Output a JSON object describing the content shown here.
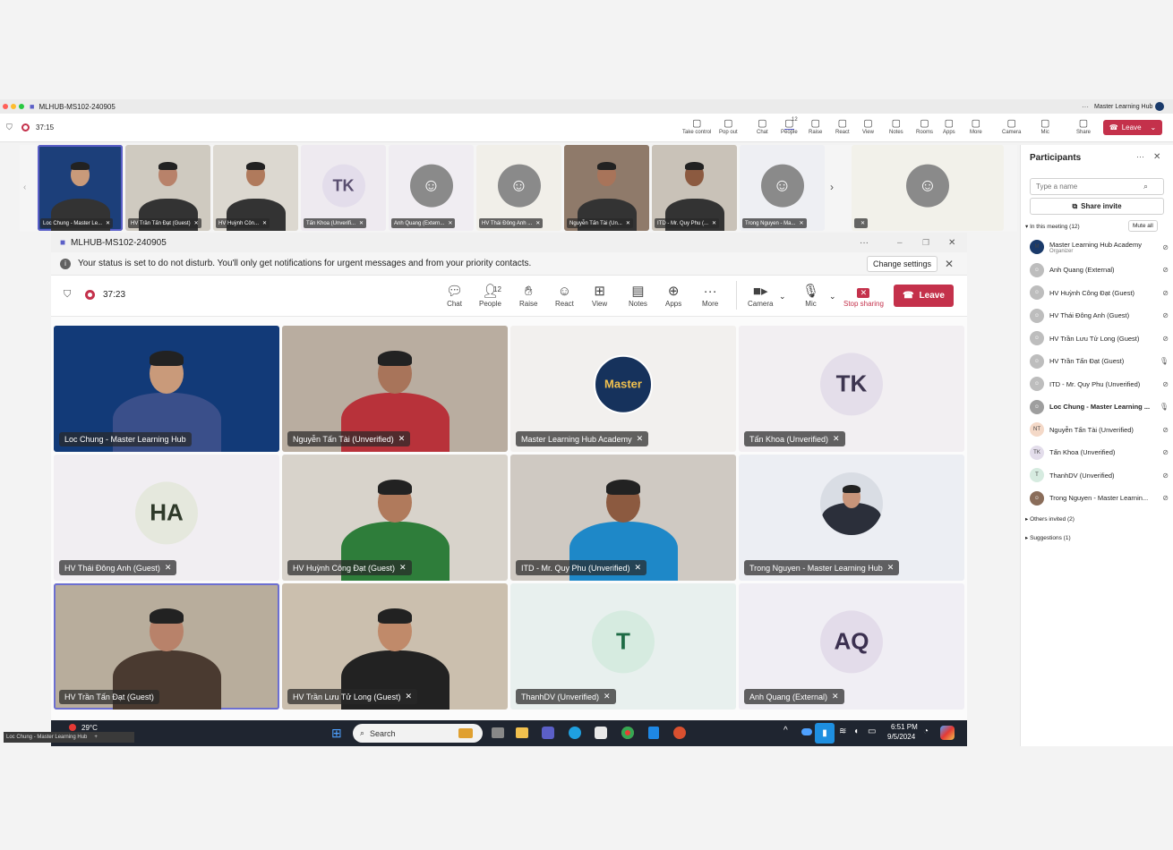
{
  "outer_window": {
    "title": "MLHUB-MS102-240905",
    "account": "Master Learning Hub",
    "timer": "37:15",
    "toolbar": [
      {
        "label": "Take control",
        "icon": "take-control-icon"
      },
      {
        "label": "Pop out",
        "icon": "pop-out-icon"
      },
      {
        "label": "Chat",
        "icon": "chat-icon"
      },
      {
        "label": "People",
        "icon": "people-icon",
        "badge": "12"
      },
      {
        "label": "Raise",
        "icon": "raise-hand-icon"
      },
      {
        "label": "React",
        "icon": "react-icon"
      },
      {
        "label": "View",
        "icon": "view-icon"
      },
      {
        "label": "Notes",
        "icon": "notes-icon"
      },
      {
        "label": "Rooms",
        "icon": "rooms-icon"
      },
      {
        "label": "Apps",
        "icon": "apps-icon"
      },
      {
        "label": "More",
        "icon": "more-icon"
      },
      {
        "label": "Camera",
        "icon": "camera-off-icon"
      },
      {
        "label": "Mic",
        "icon": "mic-off-icon"
      },
      {
        "label": "Share",
        "icon": "share-icon"
      }
    ],
    "leave_label": "Leave"
  },
  "filmstrip": [
    {
      "label": "Loc Chung - Master Le...",
      "kind": "video",
      "bg": "#1c3f7a",
      "skin": "#c99a7a"
    },
    {
      "label": "HV Trần Tấn Đạt (Guest)",
      "kind": "video",
      "bg": "#cfcac0",
      "skin": "#b8826a"
    },
    {
      "label": "HV Huỳnh Côn...",
      "kind": "video",
      "bg": "#dcd8d0",
      "skin": "#b07a5c"
    },
    {
      "label": "Tấn Khoa (Unverifi...",
      "kind": "initials",
      "initials": "TK",
      "bg": "#eeeaf0",
      "circle": "#e3ddeb",
      "color": "#5a4f70"
    },
    {
      "label": "Anh Quang (Extern...",
      "kind": "avatar",
      "bg": "#f0edf2"
    },
    {
      "label": "HV Thái Đông Anh ...",
      "kind": "avatar",
      "bg": "#f1efe9"
    },
    {
      "label": "Nguyễn Tấn Tài (Un...",
      "kind": "video",
      "bg": "#8f7a6a",
      "skin": "#a8745a"
    },
    {
      "label": "ITD - Mr. Quy Phu (...",
      "kind": "video",
      "bg": "#c9c2b8",
      "skin": "#8c5a40"
    },
    {
      "label": "Trong Nguyen - Ma...",
      "kind": "avatar",
      "bg": "#eeeff3"
    },
    {
      "label": "",
      "kind": "avatar",
      "bg": "#f2f1ea"
    }
  ],
  "inner_window": {
    "title": "MLHUB-MS102-240905",
    "dnd_message": "Your status is set to do not disturb. You'll only get notifications for urgent messages and from your priority contacts.",
    "change_settings": "Change settings",
    "timer": "37:23",
    "toolbar": [
      {
        "label": "Chat",
        "icon": "chat-icon"
      },
      {
        "label": "People",
        "icon": "people-icon",
        "badge": "12"
      },
      {
        "label": "Raise",
        "icon": "raise-hand-icon"
      },
      {
        "label": "React",
        "icon": "react-icon"
      },
      {
        "label": "View",
        "icon": "view-icon"
      },
      {
        "label": "Notes",
        "icon": "notes-icon"
      },
      {
        "label": "Apps",
        "icon": "apps-icon"
      },
      {
        "label": "More",
        "icon": "more-icon"
      }
    ],
    "camera_label": "Camera",
    "mic_label": "Mic",
    "stop_sharing_label": "Stop sharing",
    "leave_label": "Leave"
  },
  "grid": [
    {
      "label": "Loc Chung - Master Learning Hub",
      "kind": "video",
      "bg": "#123a78",
      "skin": "#c99a7a",
      "shirt": "#3a4f8a",
      "muted": false
    },
    {
      "label": "Nguyễn Tấn Tài (Unverified)",
      "kind": "video",
      "bg": "#b9ada0",
      "skin": "#a8745a",
      "shirt": "#b8323a",
      "muted": true
    },
    {
      "label": "Master Learning Hub Academy",
      "kind": "logo",
      "bg": "#f2f0ee",
      "logo_text": "Master",
      "muted": true
    },
    {
      "label": "Tấn Khoa (Unverified)",
      "kind": "initials",
      "initials": "TK",
      "bg": "#f2eff2",
      "circle": "#e4deea",
      "color": "#3d3550",
      "muted": true
    },
    {
      "label": "HV Thái Đông Anh (Guest)",
      "kind": "initials",
      "initials": "HA",
      "bg": "#f1eef2",
      "circle": "#e5e8dd",
      "color": "#2f3a2a",
      "muted": true
    },
    {
      "label": "HV Huỳnh Công Đạt (Guest)",
      "kind": "video",
      "bg": "#d8d3cb",
      "skin": "#b07a5c",
      "shirt": "#2e7d3a",
      "muted": true
    },
    {
      "label": "ITD - Mr. Quy Phu (Unverified)",
      "kind": "video",
      "bg": "#cfc9c2",
      "skin": "#8c5a40",
      "shirt": "#1e88c8",
      "muted": true
    },
    {
      "label": "Trong Nguyen - Master Learning Hub",
      "kind": "photo",
      "bg": "#eceef3",
      "skin": "#c8957a",
      "shirt": "#2b2f3a",
      "muted": true
    },
    {
      "label": "HV Trần Tấn Đạt (Guest)",
      "kind": "video",
      "bg": "#b8ad9c",
      "skin": "#b8826a",
      "shirt": "#4a3a30",
      "muted": false
    },
    {
      "label": "HV Trần Lưu Tử Long (Guest)",
      "kind": "video",
      "bg": "#cbbfae",
      "skin": "#c08a6a",
      "shirt": "#222222",
      "muted": true
    },
    {
      "label": "ThanhDV (Unverified)",
      "kind": "initials",
      "initials": "T",
      "bg": "#e8f0ee",
      "circle": "#d6ebe0",
      "color": "#1e6b45",
      "muted": true
    },
    {
      "label": "Anh Quang (External)",
      "kind": "initials",
      "initials": "AQ",
      "bg": "#f0eef4",
      "circle": "#e3dcea",
      "color": "#3b3050",
      "muted": true
    }
  ],
  "taskbar": {
    "weather": "29°C",
    "search": "Search",
    "time": "6:51 PM",
    "date": "9/5/2024",
    "tooltip": "Loc Chung - Master Learning Hub"
  },
  "participants": {
    "title": "Participants",
    "search_placeholder": "Type a name",
    "share_invite": "Share invite",
    "in_meeting": "In this meeting (12)",
    "mute_all": "Mute all",
    "list": [
      {
        "name": "Master Learning Hub Academy",
        "sub": "Organizer",
        "initials": "M",
        "color": "#1a3a6a",
        "mic": "off"
      },
      {
        "name": "Anh Quang (External)",
        "initials": "",
        "color": "#bdbdbd",
        "mic": "off"
      },
      {
        "name": "HV Huỳnh Công Đạt (Guest)",
        "initials": "",
        "color": "#bdbdbd",
        "mic": "off"
      },
      {
        "name": "HV Thái Đông Anh (Guest)",
        "initials": "",
        "color": "#bdbdbd",
        "mic": "off"
      },
      {
        "name": "HV Trần Lưu Tử Long (Guest)",
        "initials": "",
        "color": "#bdbdbd",
        "mic": "off"
      },
      {
        "name": "HV Trần Tấn Đạt (Guest)",
        "initials": "",
        "color": "#bdbdbd",
        "mic": "on"
      },
      {
        "name": "ITD - Mr. Quy Phu (Unverified)",
        "initials": "",
        "color": "#bdbdbd",
        "mic": "off"
      },
      {
        "name": "Loc Chung - Master Learning ...",
        "initials": "",
        "color": "#9e9e9e",
        "mic": "on"
      },
      {
        "name": "Nguyễn Tấn Tài (Unverified)",
        "initials": "NT",
        "color": "#f4d9c8",
        "mic": "off"
      },
      {
        "name": "Tấn Khoa (Unverified)",
        "initials": "TK",
        "color": "#e3ddeb",
        "mic": "off"
      },
      {
        "name": "ThanhDV (Unverified)",
        "initials": "T",
        "color": "#d6ebe0",
        "mic": "off"
      },
      {
        "name": "Trong Nguyen - Master Learnin...",
        "initials": "",
        "color": "#8a6d5a",
        "mic": "off"
      }
    ],
    "others_invited": "Others invited (2)",
    "suggestions": "Suggestions (1)"
  }
}
